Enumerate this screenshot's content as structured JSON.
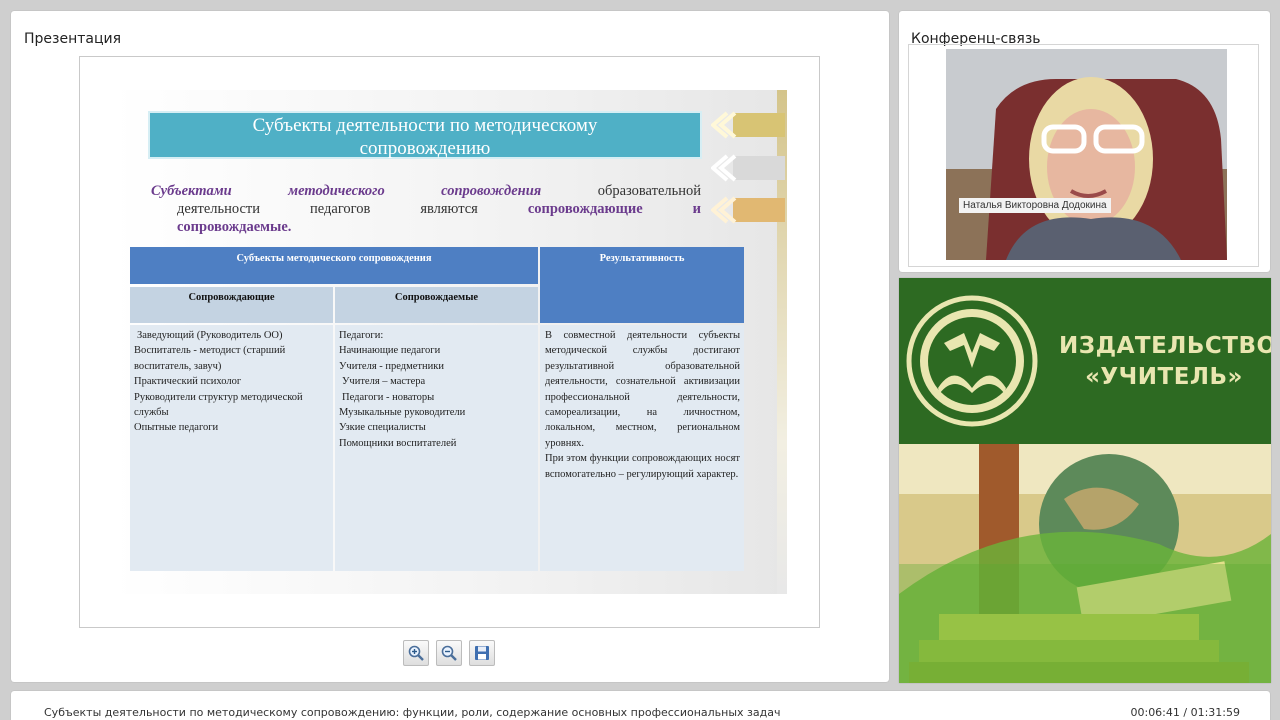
{
  "presentation": {
    "title": "Презентация",
    "slide": {
      "title_line1": "Субъекты деятельности по методическому",
      "title_line2": "сопровождению",
      "intro_bold1": "Субъектами методического сопровождения",
      "intro_text1": "образовательной",
      "intro_text2": "деятельности педагогов являются",
      "intro_bold2": "сопровождающие и",
      "intro_bold3": "сопровождаемые.",
      "table": {
        "header_subjects": "Субъекты методического сопровождения",
        "header_result": "Результативность",
        "col_accompanying": "Сопровождающие",
        "col_accompanied": "Сопровождаемые",
        "accompanying_items": [
          "Заведующий (Руководитель ОО)",
          "Воспитатель -  методист (старший воспитатель, завуч)",
          "Практический психолог",
          "Руководители структур методической службы",
          "Опытные педагоги"
        ],
        "accompanied_items": [
          "Педагоги:",
          "Начинающие  педагоги",
          "Учителя - предметники",
          "Учителя – мастера",
          "Педагоги - новаторы",
          "Музыкальные руководители",
          "Узкие специалисты",
          "Помощники воспитателей"
        ],
        "result_paragraph1": "В совместной деятельности субъекты методической службы достигают результативной образовательной деятельности, сознательной активизации профессиональной деятельности, самореализации, на личностном, локальном, местном, региональном уровнях.",
        "result_paragraph2": "При этом функции сопровождающих носят вспомогательно – регулирующий характер."
      }
    },
    "toolbar": {
      "zoom_in_icon": "zoom-in-icon",
      "zoom_out_icon": "zoom-out-icon",
      "save_icon": "save-icon"
    }
  },
  "conference": {
    "title": "Конференц-связь",
    "speaker_name": "Наталья Викторовна Додокина"
  },
  "publisher": {
    "line1": "ИЗДАТЕЛЬСТВО",
    "line2": "«УЧИТЕЛЬ»",
    "bg_color": "#2d6a22",
    "text_color": "#e9e6b0"
  },
  "footer": {
    "course_title": "Субъекты деятельности по методическому сопровождению: функции, роли, содержание основных профессиональных задач",
    "time": "00:06:41 / 01:31:59"
  }
}
